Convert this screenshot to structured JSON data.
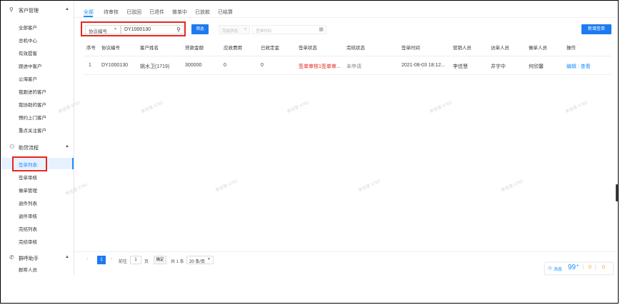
{
  "sidebar": {
    "groups": [
      {
        "icon": "customer-icon",
        "icon_glyph": "⚲",
        "label": "客户管理",
        "items": [
          "全部客户",
          "总机中心",
          "有效提客",
          "跟进中客户",
          "公海客户",
          "我跟进的客户",
          "我协助的客户",
          "预约上门客户",
          "重点关注客户"
        ]
      },
      {
        "icon": "workflow-icon",
        "icon_glyph": "⚇",
        "label": "助贷流程",
        "items": [
          "签单列表",
          "签单审核",
          "做单管理",
          "退件列表",
          "退件审核",
          "完结列表",
          "完结审核"
        ]
      },
      {
        "icon": "phone-icon",
        "icon_glyph": "✆",
        "label": "群呼助手",
        "items": [
          "群呼人员"
        ]
      }
    ],
    "active_item": "签单列表"
  },
  "tabs": [
    "全部",
    "待审核",
    "已驳回",
    "已退件",
    "做单中",
    "已放款",
    "已结算"
  ],
  "active_tab": "全部",
  "filters": {
    "field_select": "协议编号",
    "search_value": "DY1000130",
    "filter_button": "筛选",
    "status_placeholder": "完结状态",
    "date_placeholder": "签单时间",
    "new_button": "新增签单"
  },
  "table": {
    "columns": [
      "序号",
      "协议编号",
      "客户姓名",
      "贷款金额",
      "应收费用",
      "已收定金",
      "签单状态",
      "完结状态",
      "签单时间",
      "营销人员",
      "访单人员",
      "做单人员",
      "操作"
    ],
    "rows": [
      {
        "index": "1",
        "agreement_no": "DY1000130",
        "customer": "姚水卫(1719)",
        "amount": "300000",
        "receivable": "0",
        "deposit": "0",
        "sign_status": "签单审核1签单审...",
        "finish_status": "未申请",
        "sign_time": "2021-08-03 18:12...",
        "marketer": "李佳慧",
        "visitor": "井宇中",
        "maker": "何欣馨",
        "action_edit": "编辑",
        "action_view": "查看"
      }
    ]
  },
  "pagination": {
    "current_page": "1",
    "goto_label": "前往",
    "goto_value": "1",
    "page_unit": "页",
    "confirm": "确定",
    "total": "共 1 条",
    "page_size": "20 条/页"
  },
  "messages": {
    "label": "消息",
    "count": "99⁺",
    "a": "0",
    "b": "0"
  },
  "watermark": "李佳慧 4763",
  "colors": {
    "accent": "#1e7af0",
    "active_bg": "#e8f1ff",
    "warn": "#e8261d",
    "highlight_box": "#e8261d"
  }
}
